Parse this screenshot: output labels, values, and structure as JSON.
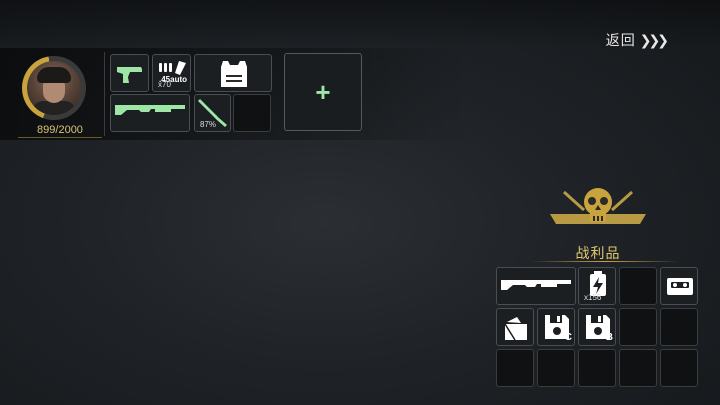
{
  "header": {
    "back_label": "返回",
    "back_chevrons": "❯❯❯"
  },
  "player": {
    "hp": "899/2000",
    "hp_fraction": 0.45
  },
  "equipment": {
    "slots": [
      {
        "id": "pistol",
        "icon": "pistol-icon",
        "color": "#9ee6a6"
      },
      {
        "id": "ammo",
        "icon": "ammo-icon",
        "label": ".45auto",
        "count": "x70"
      },
      {
        "id": "armor",
        "icon": "armor-vest-icon"
      },
      {
        "id": "shotgun",
        "icon": "shotgun-icon",
        "color": "#9ee6a6"
      },
      {
        "id": "knife",
        "icon": "knife-icon",
        "durability": "87%",
        "color": "#9ee6a6"
      },
      {
        "id": "empty",
        "icon": ""
      }
    ],
    "add_label": "+"
  },
  "loot": {
    "title": "战利品",
    "emblem_text": "DEAD HEAD",
    "items": [
      {
        "icon": "shotgun-icon"
      },
      {
        "icon": "shotgun-icon"
      },
      {
        "icon": "battery-icon",
        "count": "x156"
      },
      {
        "icon": ""
      },
      {
        "icon": "cassette-icon"
      },
      {
        "icon": "wallet-icon"
      },
      {
        "icon": "floppy-disk-icon",
        "tag": "C"
      },
      {
        "icon": "floppy-disk-icon",
        "tag": "B"
      },
      {
        "icon": ""
      },
      {
        "icon": ""
      },
      {
        "icon": ""
      },
      {
        "icon": ""
      },
      {
        "icon": ""
      },
      {
        "icon": ""
      },
      {
        "icon": ""
      }
    ]
  },
  "colors": {
    "accent_gold": "#c9a33c",
    "weapon_green": "#9ee6a6"
  }
}
